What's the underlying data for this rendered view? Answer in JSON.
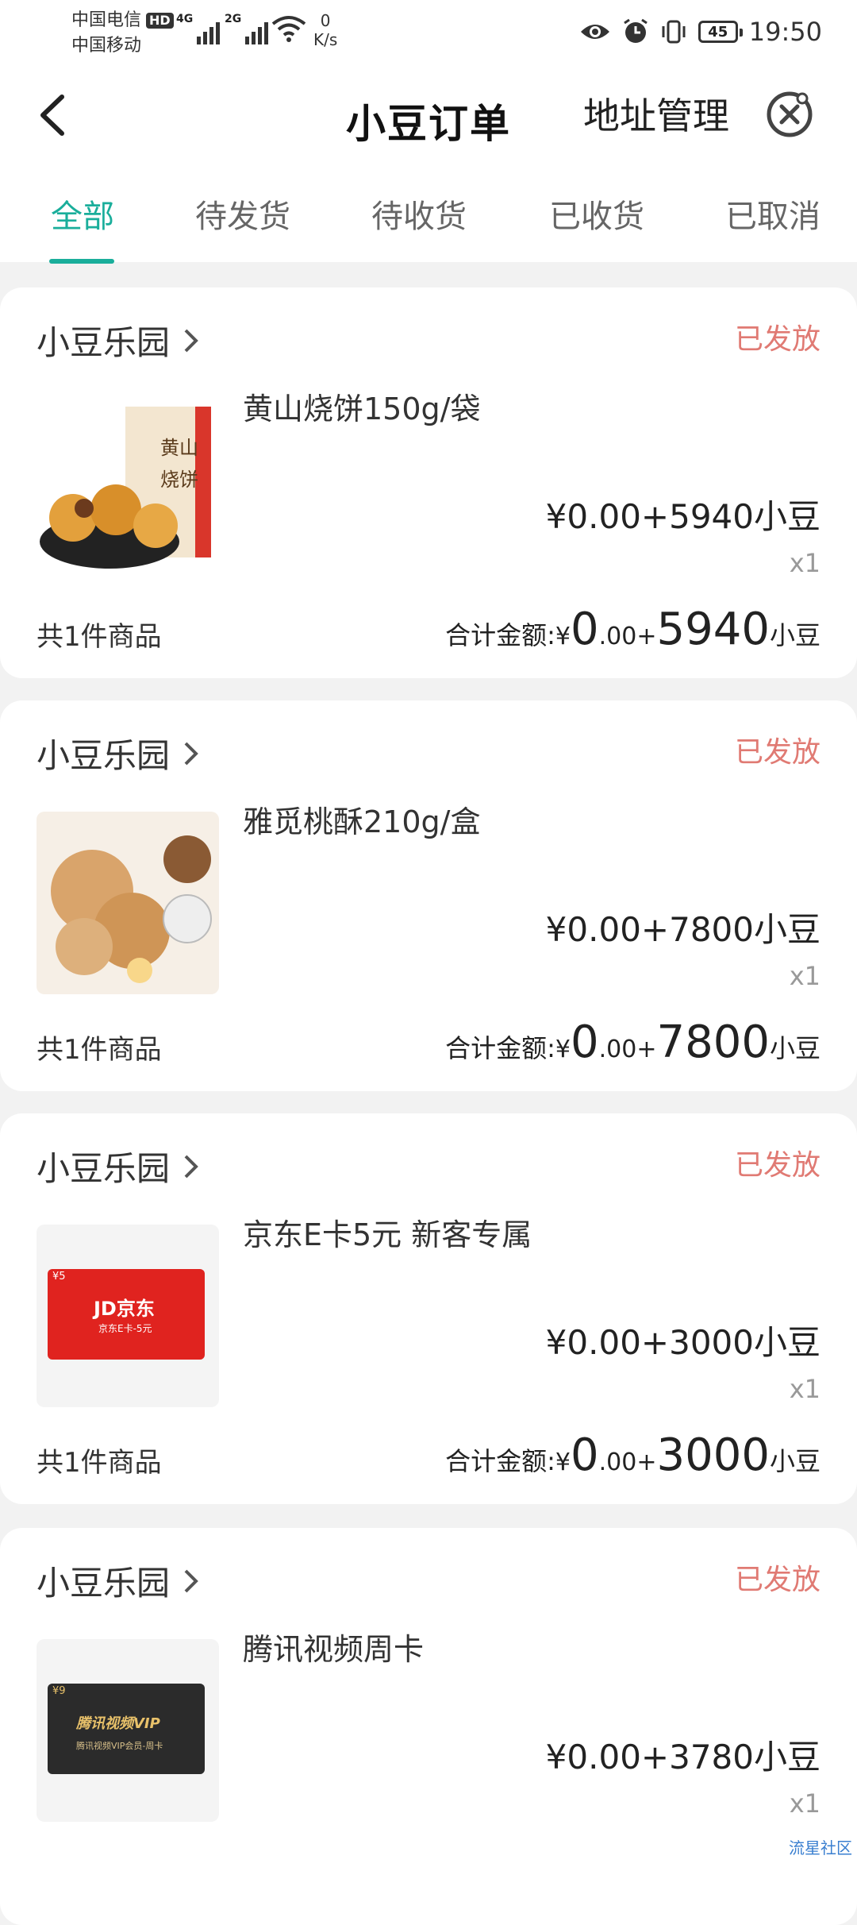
{
  "status_bar": {
    "carrier1": "中国电信",
    "carrier1_badge": "HD",
    "carrier2": "中国移动",
    "sig1_label": "4G",
    "sig2_label": "2G",
    "net_speed_value": "0",
    "net_speed_unit": "K/s",
    "battery": "45",
    "time": "19:50"
  },
  "header": {
    "title": "小豆订单",
    "address_link": "地址管理"
  },
  "tabs": [
    {
      "label": "全部",
      "active": true
    },
    {
      "label": "待发货",
      "active": false
    },
    {
      "label": "待收货",
      "active": false
    },
    {
      "label": "已收货",
      "active": false
    },
    {
      "label": "已取消",
      "active": false
    }
  ],
  "orders": [
    {
      "shop": "小豆乐园",
      "status": "已发放",
      "product": "黄山烧饼150g/袋",
      "price": "¥0.00+5940小豆",
      "qty": "x1",
      "count": "共1件商品",
      "total_label": "合计金额:",
      "total_yen": "¥",
      "total_int": "0",
      "total_dec": ".00+",
      "total_beans": "5940",
      "total_unit": "小豆",
      "thumb_text": "黄山烧饼"
    },
    {
      "shop": "小豆乐园",
      "status": "已发放",
      "product": "雅觅桃酥210g/盒",
      "price": "¥0.00+7800小豆",
      "qty": "x1",
      "count": "共1件商品",
      "total_label": "合计金额:",
      "total_yen": "¥",
      "total_int": "0",
      "total_dec": ".00+",
      "total_beans": "7800",
      "total_unit": "小豆"
    },
    {
      "shop": "小豆乐园",
      "status": "已发放",
      "product": "京东E卡5元 新客专属",
      "price": "¥0.00+3000小豆",
      "qty": "x1",
      "count": "共1件商品",
      "total_label": "合计金额:",
      "total_yen": "¥",
      "total_int": "0",
      "total_dec": ".00+",
      "total_beans": "3000",
      "total_unit": "小豆",
      "thumb_text": "JD京东",
      "thumb_sub": "京东E卡-5元",
      "thumb_badge": "¥5"
    },
    {
      "shop": "小豆乐园",
      "status": "已发放",
      "product": "腾讯视频周卡",
      "price": "¥0.00+3780小豆",
      "qty": "x1",
      "thumb_text": "腾讯视频VIP",
      "thumb_sub": "腾讯视频VIP会员-周卡",
      "thumb_badge": "¥9"
    }
  ],
  "watermark": "流星社区",
  "colors": {
    "accent": "#1aae9b",
    "status": "#e07a73",
    "background": "#f2f2f2"
  }
}
